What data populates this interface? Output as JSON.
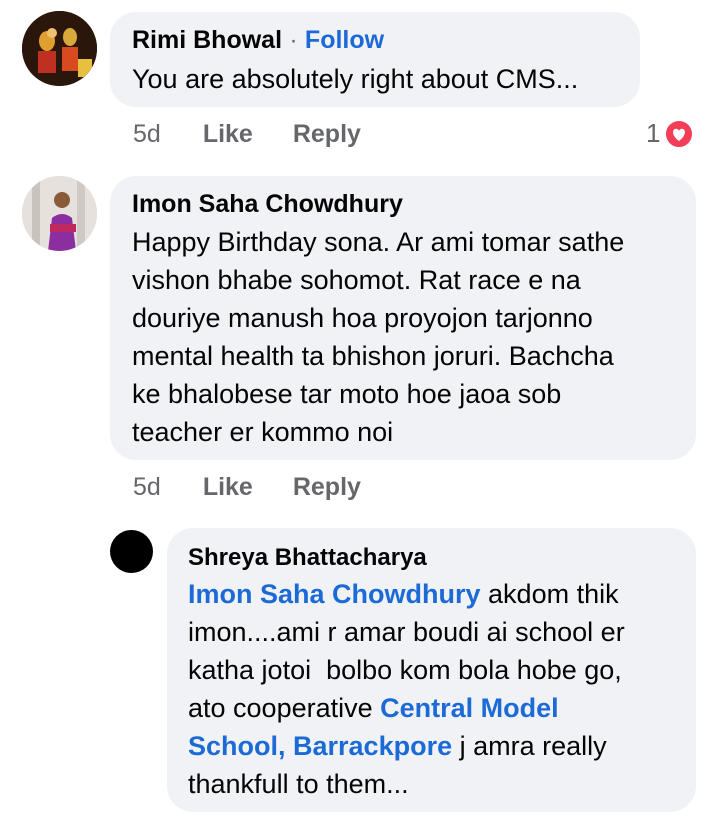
{
  "comments": [
    {
      "author": "Rimi Bhowal",
      "follow_sep": "·",
      "follow_label": "Follow",
      "text": "You are absolutely right about CMS...",
      "time": "5d",
      "like_label": "Like",
      "reply_label": "Reply",
      "reaction_count": "1",
      "reaction_icon": "love-reaction-icon"
    },
    {
      "author": "Imon Saha Chowdhury",
      "lines": [
        "Happy Birthday sona. Ar ami tomar sathe",
        "vishon bhabe sohomot. Rat race e na",
        "douriye manush hoa proyojon tarjonno",
        "mental health ta bhishon joruri. Bachcha",
        "ke bhalobese tar moto hoe jaoa sob",
        "teacher er kommo noi"
      ],
      "time": "5d",
      "like_label": "Like",
      "reply_label": "Reply"
    }
  ],
  "reply": {
    "author": "Shreya Bhattacharya",
    "mention1": "Imon Saha Chowdhury",
    "t1": " akdom thik",
    "line2": "imon....ami r amar boudi ai school er",
    "line3": "katha jotoi  bolbo kom bola hobe go,",
    "line4_pre": "ato cooperative ",
    "mention2a": "Central Model",
    "mention2b": "School, Barrackpore",
    "line5_post": " j amra really",
    "line6": "thankfull to them..."
  },
  "colors": {
    "bubble": "#f0f2f5",
    "link": "#1c6ad6",
    "meta": "#65676b",
    "love": "#f33e58"
  }
}
